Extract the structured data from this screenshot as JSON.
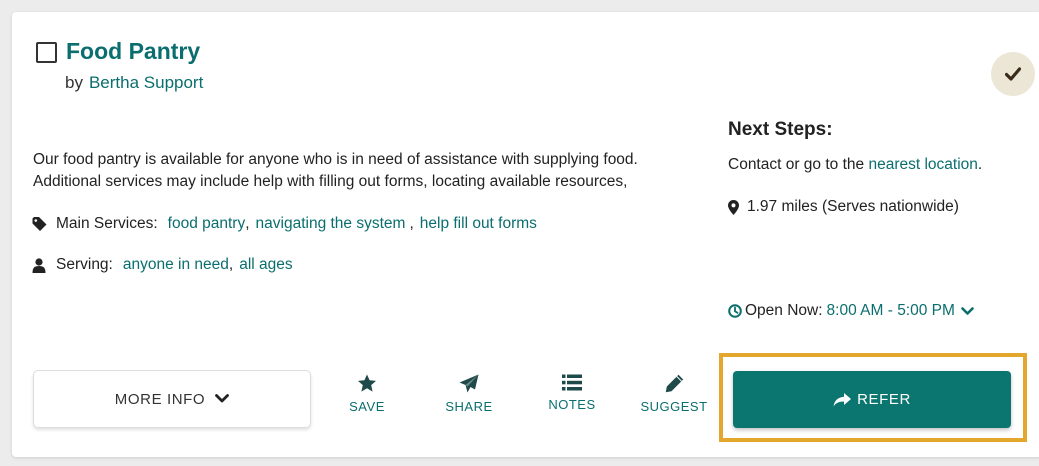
{
  "listing": {
    "title": "Food Pantry",
    "by_prefix": "by",
    "provider": "Bertha Support",
    "description_line1": "Our food pantry is available for anyone who is in need of assistance with supplying food.",
    "description_line2": "Additional services may include help with filling out forms, locating available resources,",
    "main_services_label": "Main Services:",
    "main_services": [
      "food pantry",
      "navigating the system",
      "help fill out forms"
    ],
    "serving_label": "Serving:",
    "serving": [
      "anyone in need",
      "all ages"
    ]
  },
  "next_steps": {
    "title": "Next Steps:",
    "text_prefix": "Contact or go to the",
    "link": "nearest location",
    "text_suffix": ".",
    "distance": "1.97 miles (Serves nationwide)",
    "hours_label": "Open Now:",
    "hours_value": "8:00 AM - 5:00 PM"
  },
  "actions": {
    "more_info": "MORE INFO",
    "save": "SAVE",
    "share": "SHARE",
    "notes": "NOTES",
    "suggest": "SUGGEST",
    "refer": "REFER"
  },
  "colors": {
    "accent": "#0b6e6e",
    "refer_bg": "#0b7570",
    "highlight": "#e3a72e",
    "check_bg": "#ece6d6"
  },
  "icons": {
    "tag": "tag-icon",
    "user": "user-icon",
    "map_marker": "map-marker-icon",
    "clock": "clock-icon",
    "check": "check-icon",
    "star": "star-icon",
    "paper_plane": "paper-plane-icon",
    "list": "list-icon",
    "pencil": "pencil-icon",
    "share_arrow": "share-arrow-icon",
    "chevron_down": "chevron-down-icon"
  }
}
